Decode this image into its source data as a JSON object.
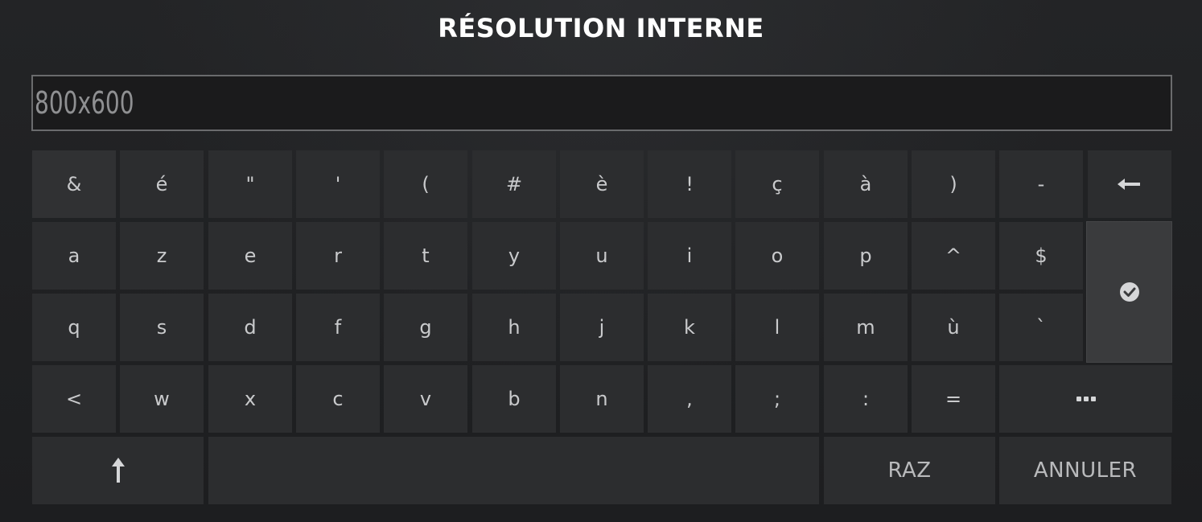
{
  "dialog": {
    "title": "RÉSOLUTION INTERNE",
    "input": {
      "value": "800x600"
    }
  },
  "keyboard": {
    "row1": [
      "&",
      "é",
      "\"",
      "'",
      "(",
      "#",
      "è",
      "!",
      "ç",
      "à",
      ")",
      "-"
    ],
    "row2": [
      "a",
      "z",
      "e",
      "r",
      "t",
      "y",
      "u",
      "i",
      "o",
      "p",
      "^",
      "$"
    ],
    "row3": [
      "q",
      "s",
      "d",
      "f",
      "g",
      "h",
      "j",
      "k",
      "l",
      "m",
      "ù",
      "`"
    ],
    "row4": [
      "<",
      "w",
      "x",
      "c",
      "v",
      "b",
      "n",
      ",",
      ";",
      ":",
      "="
    ],
    "backspace_icon": "backspace-arrow-icon",
    "enter_icon": "check-circle-icon",
    "more_icon": "ellipsis-icon",
    "shift_icon": "shift-up-arrow-icon",
    "reset_label": "RAZ",
    "cancel_label": "ANNULER"
  }
}
